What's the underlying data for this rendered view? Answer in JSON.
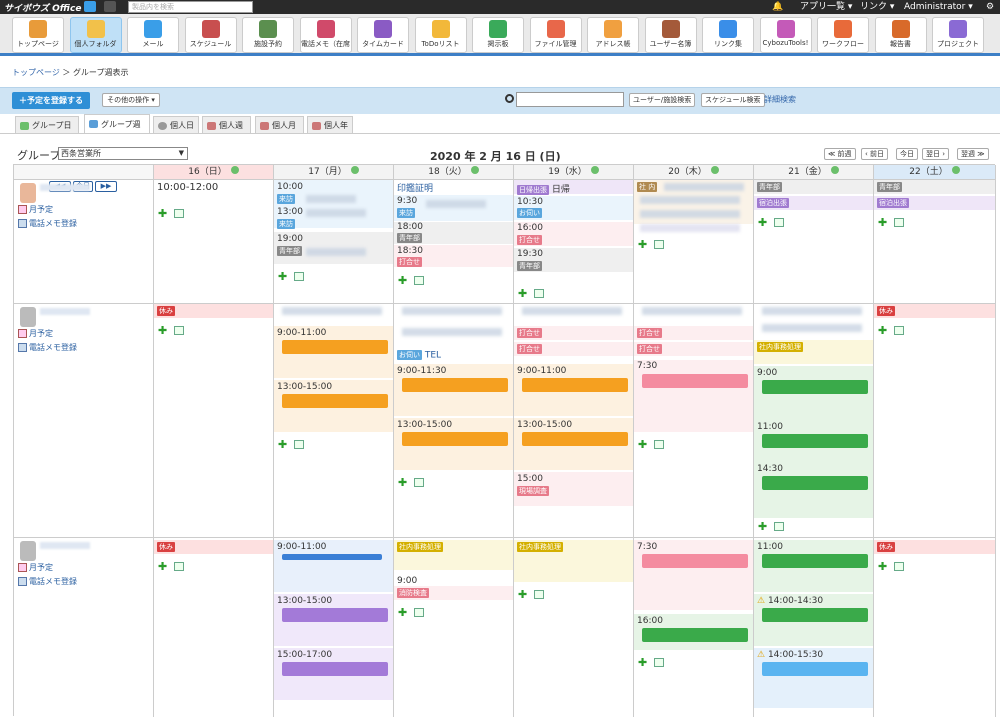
{
  "topbar": {
    "logo": "サイボウズ Office",
    "search_placeholder": "製品内を検索",
    "apps_menu": "アプリ一覧 ▾",
    "link_menu": "リンク ▾",
    "user": "Administrator ▾"
  },
  "apps": [
    {
      "label": "トップページ",
      "color": "#e89b3a"
    },
    {
      "label": "個人フォルダ",
      "color": "#f2c14a"
    },
    {
      "label": "メール",
      "color": "#3a9ee8"
    },
    {
      "label": "スケジュール",
      "color": "#c84f4f"
    },
    {
      "label": "施設予約",
      "color": "#5b8f4f"
    },
    {
      "label": "電話メモ（在席",
      "color": "#d04a6a"
    },
    {
      "label": "タイムカード",
      "color": "#8a5bc4"
    },
    {
      "label": "ToDoリスト",
      "color": "#f2b83a"
    },
    {
      "label": "掲示板",
      "color": "#3aaa5a"
    },
    {
      "label": "ファイル管理",
      "color": "#e8674a"
    },
    {
      "label": "アドレス帳",
      "color": "#f0a040"
    },
    {
      "label": "ユーザー名簿",
      "color": "#a45a3a"
    },
    {
      "label": "リンク集",
      "color": "#3a8ee8"
    },
    {
      "label": "CybozuTools!",
      "color": "#c45ab8"
    },
    {
      "label": "ワークフロー",
      "color": "#e86a3a"
    },
    {
      "label": "報告書",
      "color": "#d86a2a"
    },
    {
      "label": "プロジェクト",
      "color": "#8a6ad4"
    }
  ],
  "breadcrumb": {
    "home": "トップページ",
    "sep": "＞",
    "current": "グループ週表示"
  },
  "toolbar": {
    "register": "＋予定を登録する",
    "other_ops": "その他の操作 ▾",
    "user_search": "ユーザー/施設検索",
    "schedule_search": "スケジュール検索",
    "detail_search": "詳細検索"
  },
  "tabs": [
    {
      "label": "グループ日"
    },
    {
      "label": "グループ週"
    },
    {
      "label": "個人日"
    },
    {
      "label": "個人週"
    },
    {
      "label": "個人月"
    },
    {
      "label": "個人年"
    }
  ],
  "group": {
    "label": "グループ",
    "selected": "西条営業所"
  },
  "date_title": "2020 年 2 月 16 日 (日)",
  "nav": {
    "prev_week": "≪ 前週",
    "prev_day": "‹ 前日",
    "today": "今日",
    "next_day": "翌日 ›",
    "next_week": "翌週 ≫"
  },
  "cal_nav": {
    "prev": "◀◀",
    "today": "今日",
    "next": "▶▶"
  },
  "days": [
    "16（日）",
    "17（月）",
    "18（火）",
    "19（水）",
    "20（木）",
    "21（金）",
    "22（土）"
  ],
  "user_links": {
    "month": "月予定",
    "phone": "電話メモ登録"
  },
  "row1": {
    "d0": [
      "10:00-12:00"
    ],
    "d1": {
      "t1": "10:00",
      "tag1": "来訪",
      "t2": "13:00",
      "tag2": "来訪",
      "t3": "19:00",
      "tag3": "青年部"
    },
    "d2": {
      "e1": "印鑑証明",
      "t1": "9:30",
      "tag1": "来訪",
      "t2": "18:00",
      "tag2": "青年部",
      "t3": "18:30",
      "tag3": "打合せ"
    },
    "d3": {
      "tag0": "日帰出張",
      "e0": "日帰",
      "t1": "10:30",
      "tag1": "お伺い",
      "t2": "16:00",
      "tag2": "打合せ",
      "t3": "19:30",
      "tag3": "青年部"
    },
    "d4": {
      "tag0": "社 内"
    },
    "d5": {
      "tag0": "青年部",
      "tag1": "宿泊出張"
    },
    "d6": {
      "tag0": "青年部",
      "tag1": "宿泊出張"
    }
  },
  "row2": {
    "d0": {
      "tag": "休み"
    },
    "d1": {
      "t1": "9:00-11:00",
      "t2": "13:00-15:00"
    },
    "d2": {
      "tag1": "お伺い",
      "e1": "TEL",
      "t1": "9:00-11:30",
      "t2": "13:00-15:00"
    },
    "d3": {
      "tag1": "打合せ",
      "tag2": "打合せ",
      "t1": "9:00-11:00",
      "t2": "13:00-15:00",
      "t3": "15:00",
      "tag3": "現場調査"
    },
    "d4": {
      "tag1": "打合せ",
      "tag2": "打合せ",
      "t1": "7:30"
    },
    "d5": {
      "tag1": "社内事務処理",
      "t1": "9:00",
      "t2": "11:00",
      "t3": "14:30"
    },
    "d6": {
      "tag": "休み"
    }
  },
  "row3": {
    "d0": {
      "tag": "休み"
    },
    "d1": {
      "t1": "9:00-11:00",
      "t2": "13:00-15:00",
      "t3": "15:00-17:00"
    },
    "d2": {
      "tag1": "社内事務処理",
      "t1": "9:00",
      "tag2": "消防検査"
    },
    "d3": {
      "tag1": "社内事務処理"
    },
    "d4": {
      "t1": "7:30",
      "t2": "16:00"
    },
    "d5": {
      "t1": "11:00",
      "t2": "14:00-14:30",
      "t3": "14:00-15:30"
    },
    "d6": {
      "tag": "休み"
    }
  }
}
